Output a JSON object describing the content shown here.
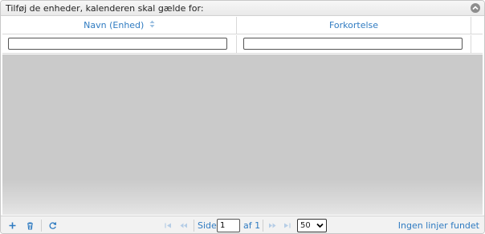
{
  "caption": {
    "title": "Tilføj de enheder, kalenderen skal gælde for:",
    "collapse_icon": "circle-chevron-up-icon"
  },
  "columns": [
    {
      "label": "Navn (Enhed)",
      "sortable": true,
      "sort_icon": "sort-arrows-icon"
    },
    {
      "label": "Forkortelse",
      "sortable": false
    }
  ],
  "filters": {
    "navn_value": "",
    "forkortelse_value": ""
  },
  "rows": [],
  "pager": {
    "actions": [
      {
        "name": "add",
        "icon": "plus-icon"
      },
      {
        "name": "delete",
        "icon": "trash-icon"
      },
      {
        "name": "refresh",
        "icon": "refresh-icon"
      }
    ],
    "nav_icons": [
      "first-page-icon",
      "prev-page-icon",
      "next-page-icon",
      "last-page-icon"
    ],
    "page_label": "Side",
    "current_page": "1",
    "of_label": "af 1",
    "rows_per_page": "50",
    "record_info": "Ingen linjer fundet"
  },
  "colors": {
    "accent": "#2f7bc1",
    "body_background": "#cacaca",
    "caption_background": "#eeeeee"
  }
}
